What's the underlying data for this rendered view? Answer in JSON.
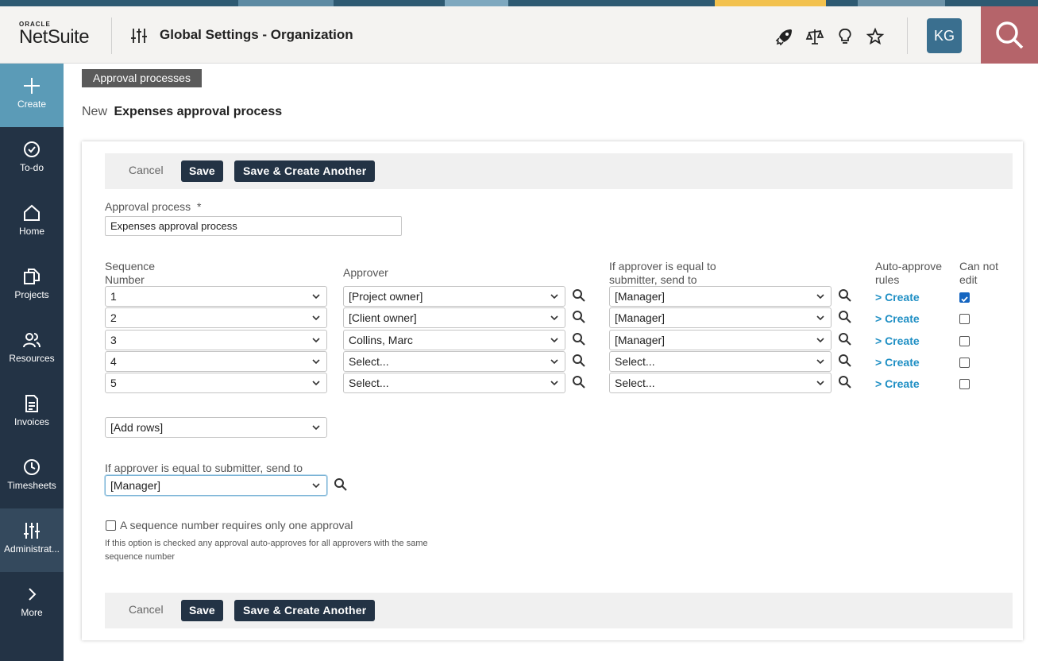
{
  "header": {
    "logo_top": "ORACLE",
    "logo_main": "NetSuite",
    "title": "Global Settings - Organization",
    "avatar_initials": "KG",
    "icons": [
      "rocket-icon",
      "scales-icon",
      "lightbulb-icon",
      "star-icon",
      "search-icon"
    ]
  },
  "sidebar": {
    "items": [
      {
        "label": "Create",
        "icon": "plus-icon"
      },
      {
        "label": "To-do",
        "icon": "check-circle-icon"
      },
      {
        "label": "Home",
        "icon": "home-icon"
      },
      {
        "label": "Projects",
        "icon": "projects-icon"
      },
      {
        "label": "Resources",
        "icon": "people-icon"
      },
      {
        "label": "Invoices",
        "icon": "document-icon"
      },
      {
        "label": "Timesheets",
        "icon": "clock-icon"
      },
      {
        "label": "Administrat...",
        "icon": "sliders-icon"
      },
      {
        "label": "More",
        "icon": "chevron-right-icon"
      }
    ]
  },
  "breadcrumb": "Approval processes",
  "heading": {
    "prefix": "New",
    "name": "Expenses approval process"
  },
  "buttons": {
    "cancel": "Cancel",
    "save": "Save",
    "save_another": "Save & Create Another"
  },
  "form": {
    "approval_process_label": "Approval process",
    "required_mark": "*",
    "approval_process_value": "Expenses approval process",
    "columns": {
      "sequence_line1": "Sequence",
      "sequence_line2": "Number",
      "approver": "Approver",
      "submitter_line1": "If approver is equal to",
      "submitter_line2": "submitter, send to",
      "auto_line1": "Auto-approve",
      "auto_line2": "rules",
      "cannot_line1": "Can not",
      "cannot_line2": "edit"
    },
    "rows": [
      {
        "seq": "1",
        "approver": "[Project owner]",
        "send_to": "[Manager]",
        "auto": "> Create",
        "cannot_edit": true
      },
      {
        "seq": "2",
        "approver": "[Client owner]",
        "send_to": "[Manager]",
        "auto": "> Create",
        "cannot_edit": false
      },
      {
        "seq": "3",
        "approver": "Collins, Marc",
        "send_to": "[Manager]",
        "auto": "> Create",
        "cannot_edit": false
      },
      {
        "seq": "4",
        "approver": "Select...",
        "send_to": "Select...",
        "auto": "> Create",
        "cannot_edit": false
      },
      {
        "seq": "5",
        "approver": "Select...",
        "send_to": "Select...",
        "auto": "> Create",
        "cannot_edit": false
      }
    ],
    "add_rows": "[Add rows]",
    "global_send_label": "If approver is equal to submitter, send to",
    "global_send_value": "[Manager]",
    "one_approval_label": "A sequence number requires only one approval",
    "one_approval_checked": false,
    "one_approval_note": "If this option is checked any approval auto-approves for all approvers with the same sequence number"
  },
  "colors": {
    "nav_bg": "#233345",
    "create_bg": "#5b9bb7",
    "search_bg": "#b5646a",
    "link": "#1f8fc4",
    "button": "#233345"
  }
}
